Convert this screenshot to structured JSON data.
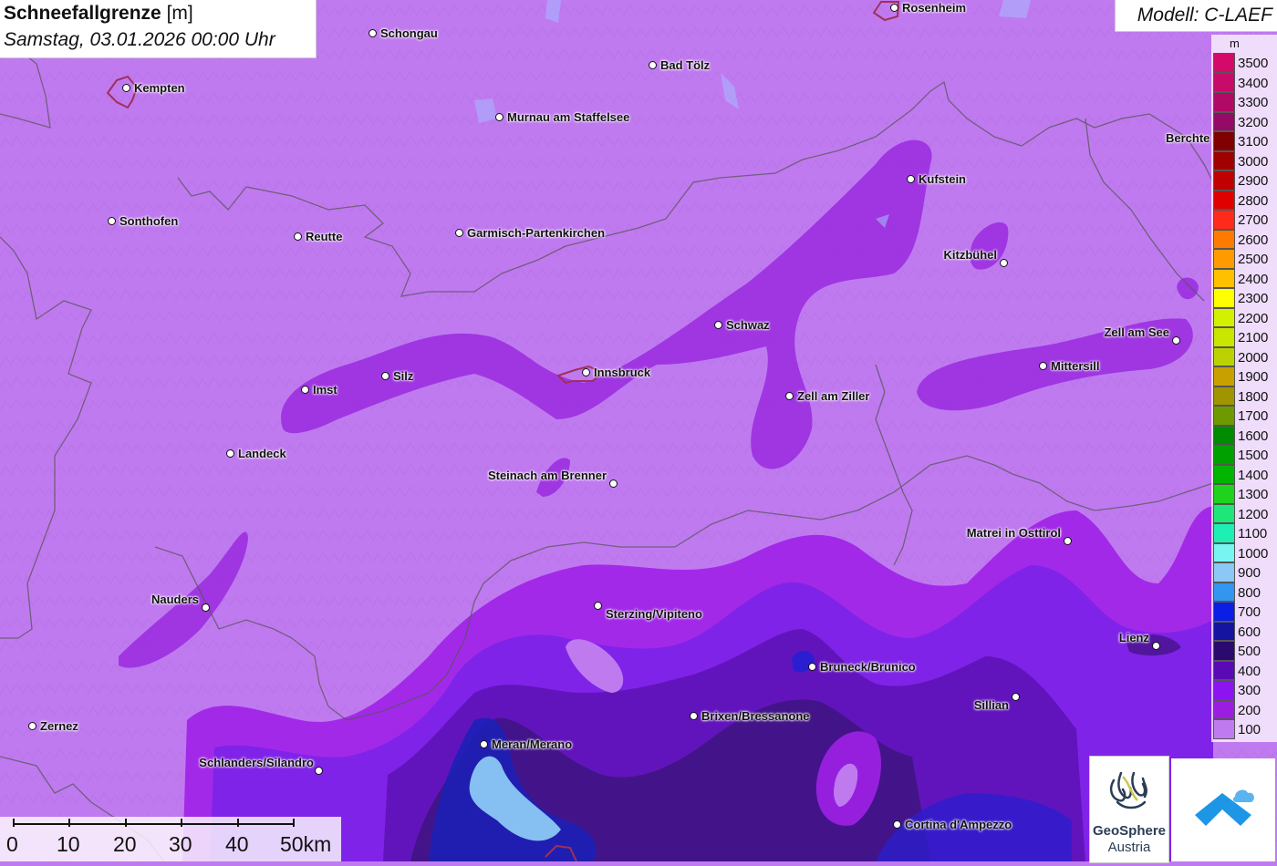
{
  "header": {
    "title": "Schneefallgrenze",
    "unit": "[m]",
    "datetime": "Samstag, 03.01.2026 00:00 Uhr",
    "model": "Modell: C-LAEF"
  },
  "legend": {
    "unit": "m",
    "entries": [
      {
        "value": "3500",
        "color": "#d40a6a"
      },
      {
        "value": "3400",
        "color": "#c80a68"
      },
      {
        "value": "3300",
        "color": "#b00a66"
      },
      {
        "value": "3200",
        "color": "#940a66"
      },
      {
        "value": "3100",
        "color": "#800000"
      },
      {
        "value": "3000",
        "color": "#a00000"
      },
      {
        "value": "2900",
        "color": "#c00000"
      },
      {
        "value": "2800",
        "color": "#e00000"
      },
      {
        "value": "2700",
        "color": "#ff2a1a"
      },
      {
        "value": "2600",
        "color": "#ff7a00"
      },
      {
        "value": "2500",
        "color": "#ff9a00"
      },
      {
        "value": "2400",
        "color": "#ffc000"
      },
      {
        "value": "2300",
        "color": "#ffff00"
      },
      {
        "value": "2200",
        "color": "#d2f000"
      },
      {
        "value": "2100",
        "color": "#c8e600"
      },
      {
        "value": "2000",
        "color": "#bcd200"
      },
      {
        "value": "1900",
        "color": "#c8a000"
      },
      {
        "value": "1800",
        "color": "#a09400"
      },
      {
        "value": "1700",
        "color": "#6e9a00"
      },
      {
        "value": "1600",
        "color": "#008c00"
      },
      {
        "value": "1500",
        "color": "#00a000"
      },
      {
        "value": "1400",
        "color": "#00b400"
      },
      {
        "value": "1300",
        "color": "#1ed21e"
      },
      {
        "value": "1200",
        "color": "#1ee678"
      },
      {
        "value": "1100",
        "color": "#1ef0b4"
      },
      {
        "value": "1000",
        "color": "#78f5f0"
      },
      {
        "value": "900",
        "color": "#8cc8f5"
      },
      {
        "value": "800",
        "color": "#3296f0"
      },
      {
        "value": "700",
        "color": "#0a1ee6"
      },
      {
        "value": "600",
        "color": "#1414a0"
      },
      {
        "value": "500",
        "color": "#2a0a6e"
      },
      {
        "value": "400",
        "color": "#5a0ab4"
      },
      {
        "value": "300",
        "color": "#8c14f0"
      },
      {
        "value": "200",
        "color": "#9b1ee0"
      },
      {
        "value": "100",
        "color": "#c07af0"
      }
    ]
  },
  "cities": [
    {
      "name": "Rosenheim"
    },
    {
      "name": "Schongau"
    },
    {
      "name": "Kempten"
    },
    {
      "name": "Bad Tölz"
    },
    {
      "name": "Murnau am Staffelsee"
    },
    {
      "name": "Berchte"
    },
    {
      "name": "Kufstein"
    },
    {
      "name": "Sonthofen"
    },
    {
      "name": "Reutte"
    },
    {
      "name": "Garmisch-Partenkirchen"
    },
    {
      "name": "Kitzbühel"
    },
    {
      "name": "Schwaz"
    },
    {
      "name": "Zell am See"
    },
    {
      "name": "Mittersill"
    },
    {
      "name": "Imst"
    },
    {
      "name": "Silz"
    },
    {
      "name": "Innsbruck"
    },
    {
      "name": "Zell am Ziller"
    },
    {
      "name": "Landeck"
    },
    {
      "name": "Steinach am Brenner"
    },
    {
      "name": "Matrei in Osttirol"
    },
    {
      "name": "Nauders"
    },
    {
      "name": "Sterzing/Vipiteno"
    },
    {
      "name": "Lienz"
    },
    {
      "name": "Bruneck/Brunico"
    },
    {
      "name": "Sillian"
    },
    {
      "name": "Brixen/Bressanone"
    },
    {
      "name": "Zernez"
    },
    {
      "name": "Meran/Merano"
    },
    {
      "name": "Schlanders/Silandro"
    },
    {
      "name": "Cortina d'Ampezzo"
    }
  ],
  "scale_bar": {
    "labels": [
      "0",
      "10",
      "20",
      "30",
      "40",
      "50km"
    ]
  },
  "logos": {
    "geosphere_name": "GeoSphere",
    "geosphere_sub": "Austria"
  }
}
